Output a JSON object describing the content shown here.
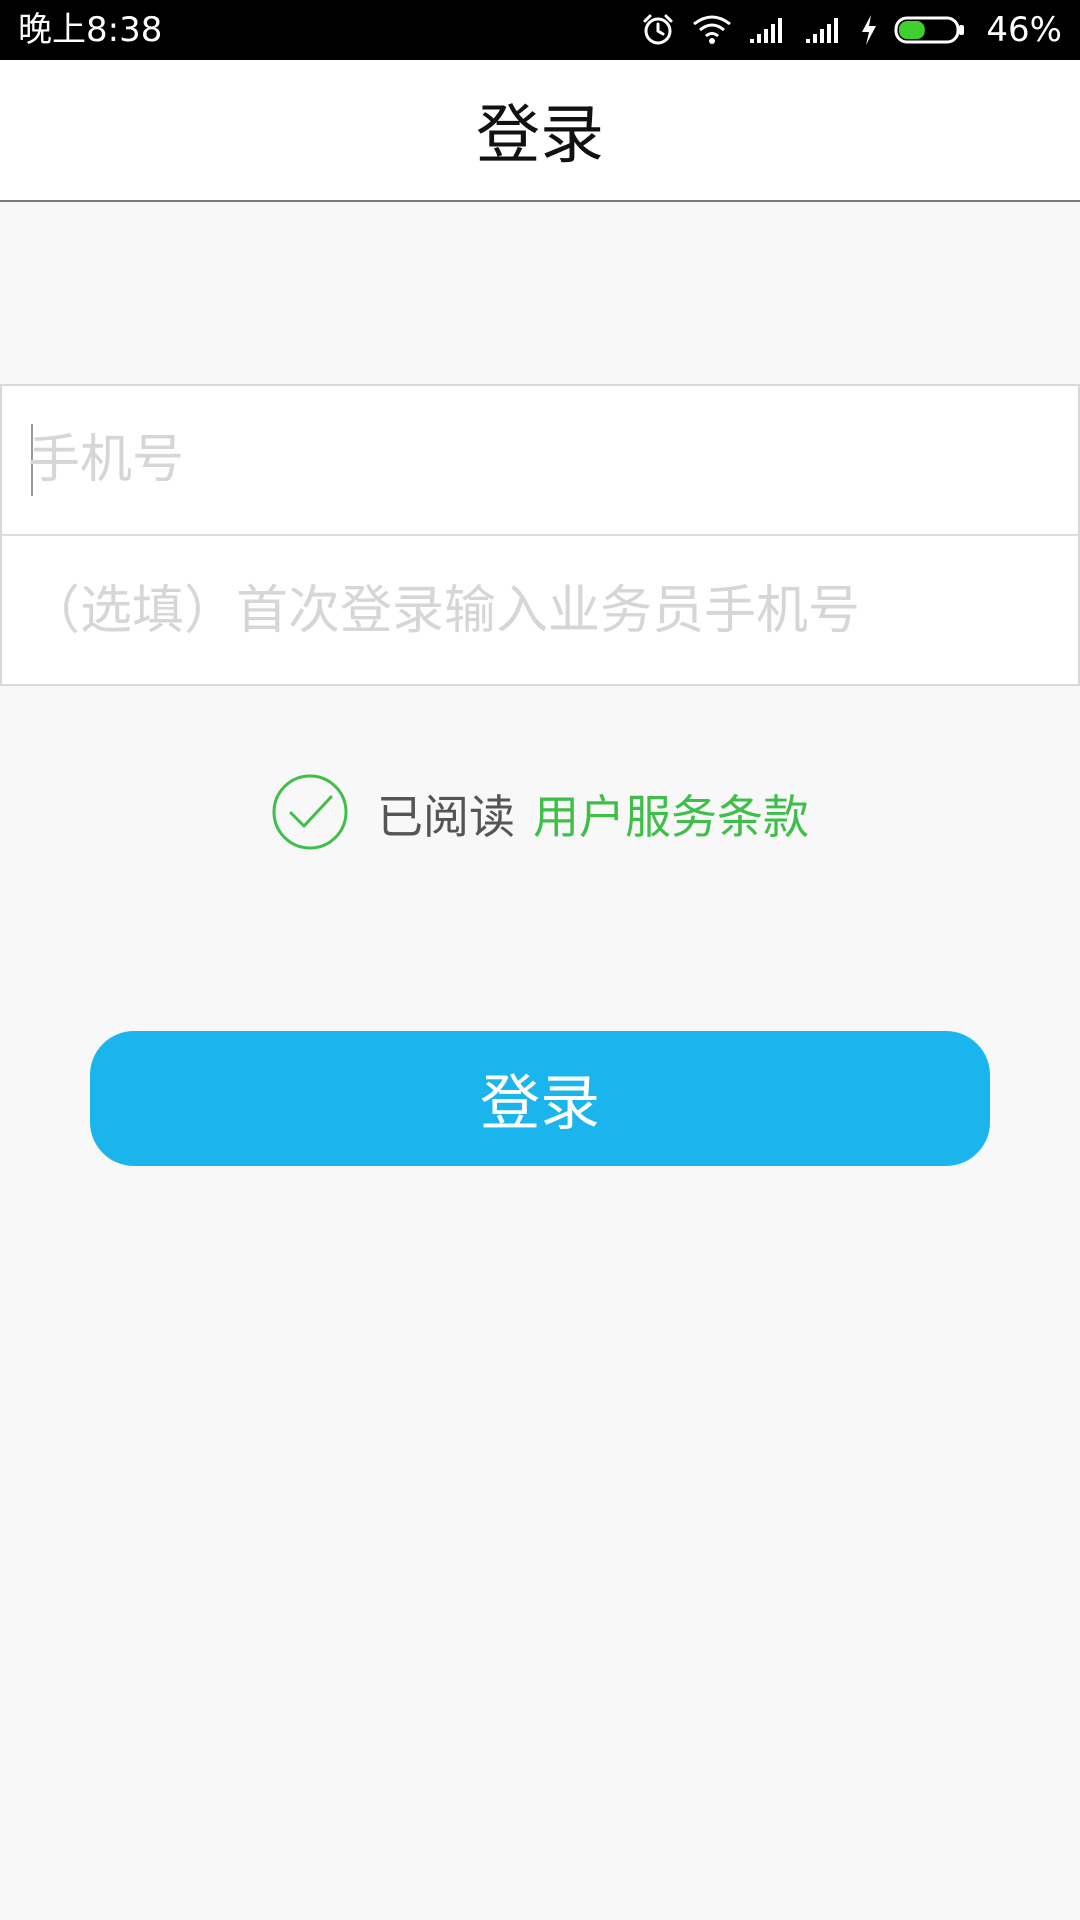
{
  "status_bar": {
    "time": "晚上8:38",
    "battery_percent": "46%",
    "battery_level": 0.46,
    "battery_color": "#3fcf2f"
  },
  "app_bar": {
    "title": "登录"
  },
  "form": {
    "phone_placeholder": "手机号",
    "salesman_placeholder": "（选填）首次登录输入业务员手机号"
  },
  "agreement": {
    "read_label": "已阅读",
    "terms_link": "用户服务条款",
    "checked": true,
    "accent_color": "#3fbf4a"
  },
  "login_button": {
    "label": "登录",
    "color": "#1ab5ec"
  }
}
